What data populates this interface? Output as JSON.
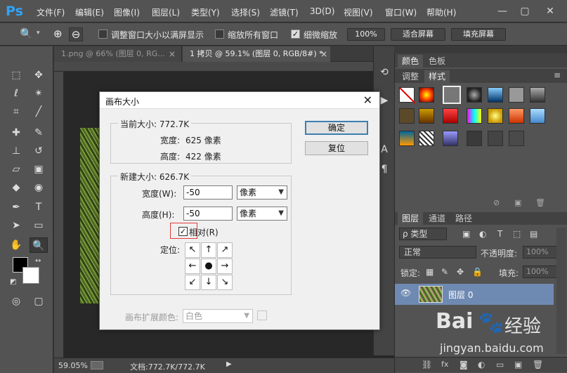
{
  "app": {
    "logo": "Ps"
  },
  "menubar": {
    "items": [
      "文件(F)",
      "编辑(E)",
      "图像(I)",
      "图层(L)",
      "类型(Y)",
      "选择(S)",
      "滤镜(T)",
      "3D(D)",
      "视图(V)",
      "窗口(W)",
      "帮助(H)"
    ],
    "window_controls": [
      "—",
      "▢",
      "✕"
    ]
  },
  "options": {
    "resize_windows": "调整窗口大小以满屏显示",
    "zoom_all": "缩放所有窗口",
    "scrubby_zoom": "细微缩放",
    "zoom_100": "100%",
    "fit_screen": "适合屏幕",
    "fill_screen": "填充屏幕"
  },
  "tabs": {
    "tab1": "1.png @ 66% (图层 0, RG...",
    "tab2": "1 拷贝 @ 59.1% (图层 0, RGB/8#) *",
    "close": "×"
  },
  "status": {
    "zoom": "59.05%",
    "doc": "文档:772.7K/772.7K"
  },
  "panels": {
    "color_tab": "颜色",
    "swatches_tab": "色板",
    "adjust_tab": "调整",
    "styles_tab": "样式",
    "layers_tab": "图层",
    "channels_tab": "通道",
    "paths_tab": "路径",
    "kind_filter": "ρ 类型",
    "blend_mode": "正常",
    "opacity_label": "不透明度:",
    "opacity_value": "100%",
    "lock_label": "锁定:",
    "fill_label": "填充:",
    "fill_value": "100%",
    "layer_name": "图层 0"
  },
  "dialog": {
    "title": "画布大小",
    "current_size_label": "当前大小: 772.7K",
    "current_width_label": "宽度:",
    "current_width_value": "625 像素",
    "current_height_label": "高度:",
    "current_height_value": "422 像素",
    "new_size_label": "新建大小: 626.7K",
    "width_label": "宽度(W):",
    "width_value": "-50",
    "width_unit": "像素",
    "height_label": "高度(H):",
    "height_value": "-50",
    "height_unit": "像素",
    "relative_label": "相对(R)",
    "anchor_label": "定位:",
    "ext_color_label": "画布扩展颜色:",
    "ext_color_value": "白色",
    "ok": "确定",
    "reset": "复位"
  },
  "watermark": {
    "brand": "Bai",
    "brand2": "经验",
    "url": "jingyan.baidu.com"
  }
}
